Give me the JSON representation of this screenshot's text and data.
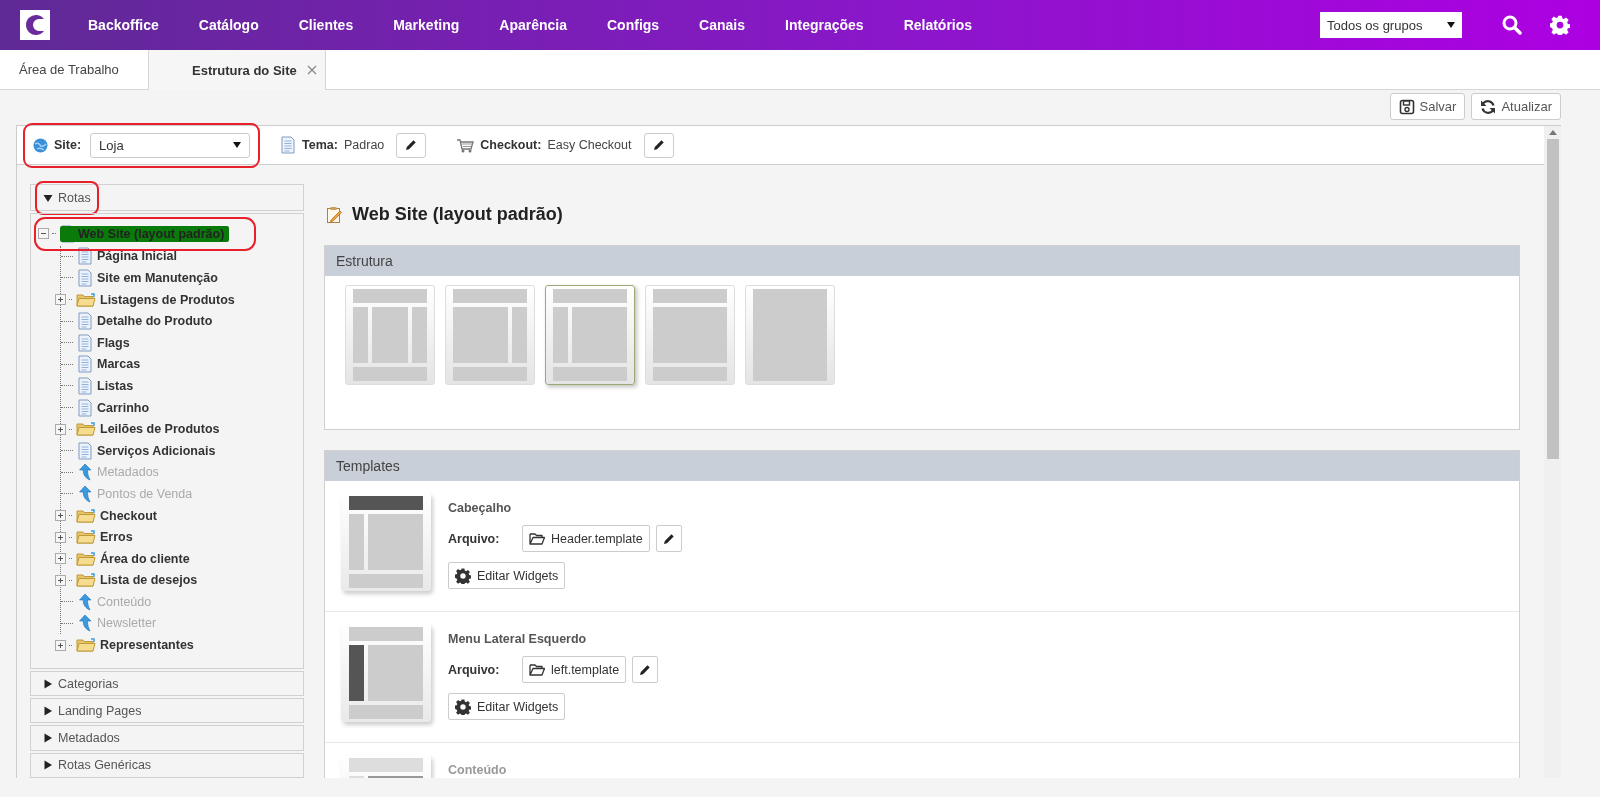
{
  "nav": {
    "items": [
      "Backoffice",
      "Catálogo",
      "Clientes",
      "Marketing",
      "Aparência",
      "Configs",
      "Canais",
      "Integrações",
      "Relatórios"
    ],
    "group_select": {
      "value": "Todos os grupos"
    }
  },
  "tabs": [
    {
      "label": "Área de Trabalho",
      "selected": false,
      "closable": false
    },
    {
      "label": "Estrutura do Site",
      "selected": true,
      "closable": true
    }
  ],
  "toolbar": {
    "buttons": [
      {
        "label": "Salvar",
        "kind": "save"
      },
      {
        "label": "Atualizar",
        "kind": "refresh"
      }
    ]
  },
  "site_bar": {
    "site": {
      "label": "Site:",
      "value": "Loja",
      "highlighted": true
    },
    "theme": {
      "label": "Tema:",
      "value": "Padrao"
    },
    "checkout": {
      "label": "Checkout:",
      "value": "Easy Checkout"
    }
  },
  "sidebar": {
    "sections": [
      {
        "title": "Rotas",
        "expanded": true,
        "highlighted": true
      },
      {
        "title": "Categorias",
        "expanded": false,
        "highlighted": false
      },
      {
        "title": "Landing Pages",
        "expanded": false,
        "highlighted": false
      },
      {
        "title": "Metadados",
        "expanded": false,
        "highlighted": false
      },
      {
        "title": "Rotas Genéricas",
        "expanded": false,
        "highlighted": false
      }
    ]
  },
  "tree": {
    "label": "Web Site (layout padrão)",
    "kind": "page",
    "selected": true,
    "expanded": true,
    "highlighted": true,
    "children": [
      {
        "label": "Página Inicial",
        "kind": "page",
        "disabled": false
      },
      {
        "label": "Site em Manutenção",
        "kind": "page",
        "disabled": false
      },
      {
        "label": "Listagens de Produtos",
        "kind": "folder",
        "expanded": false,
        "disabled": false
      },
      {
        "label": "Detalhe do Produto",
        "kind": "page",
        "disabled": false
      },
      {
        "label": "Flags",
        "kind": "page",
        "disabled": false
      },
      {
        "label": "Marcas",
        "kind": "page",
        "disabled": false
      },
      {
        "label": "Listas",
        "kind": "page",
        "disabled": false
      },
      {
        "label": "Carrinho",
        "kind": "page",
        "disabled": false
      },
      {
        "label": "Leilões de Produtos",
        "kind": "folder",
        "expanded": false,
        "disabled": false
      },
      {
        "label": "Serviços Adicionais",
        "kind": "page",
        "disabled": false
      },
      {
        "label": "Metadados",
        "kind": "link",
        "disabled": true
      },
      {
        "label": "Pontos de Venda",
        "kind": "link",
        "disabled": true
      },
      {
        "label": "Checkout",
        "kind": "folder",
        "expanded": false,
        "disabled": false
      },
      {
        "label": "Erros",
        "kind": "folder",
        "expanded": false,
        "disabled": false
      },
      {
        "label": "Área do cliente",
        "kind": "folder",
        "expanded": false,
        "disabled": false
      },
      {
        "label": "Lista de desejos",
        "kind": "folder",
        "expanded": false,
        "disabled": false
      },
      {
        "label": "Conteúdo",
        "kind": "link",
        "disabled": true
      },
      {
        "label": "Newsletter",
        "kind": "link",
        "disabled": true
      },
      {
        "label": "Representantes",
        "kind": "folder",
        "expanded": false,
        "disabled": false
      }
    ]
  },
  "main": {
    "title": "Web Site (layout padrão)",
    "structure": {
      "title": "Estrutura",
      "layouts": [
        {
          "kind": "three-column",
          "selected": false
        },
        {
          "kind": "right-sidebar",
          "selected": false
        },
        {
          "kind": "left-sidebar",
          "selected": true
        },
        {
          "kind": "no-sidebar",
          "selected": false
        },
        {
          "kind": "full",
          "selected": false
        }
      ]
    },
    "templates": {
      "title": "Templates",
      "items": [
        {
          "name": "Cabeçalho",
          "kind": "header",
          "disabled": false,
          "file_label": "Arquivo:",
          "file": "Header.template",
          "action": "Editar Widgets"
        },
        {
          "name": "Menu Lateral Esquerdo",
          "kind": "left",
          "disabled": false,
          "file_label": "Arquivo:",
          "file": "left.template",
          "action": "Editar Widgets"
        },
        {
          "name": "Conteúdo",
          "kind": "content",
          "disabled": true
        }
      ]
    }
  }
}
